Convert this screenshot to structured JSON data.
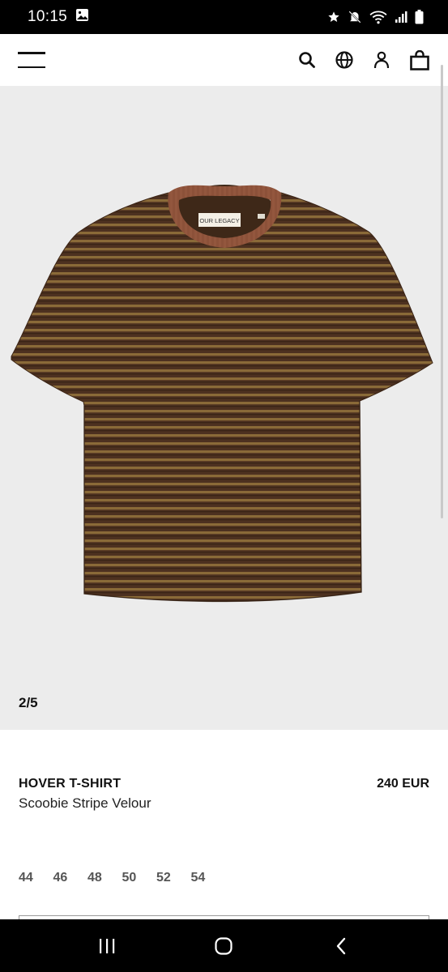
{
  "status_bar": {
    "time": "10:15",
    "icons": [
      "image-icon",
      "star-icon",
      "mute-icon",
      "wifi-icon",
      "signal-icon",
      "battery-icon"
    ]
  },
  "header": {
    "icons": [
      "menu-icon",
      "search-icon",
      "globe-icon",
      "account-icon",
      "bag-icon"
    ]
  },
  "gallery": {
    "counter": "2/5",
    "image_subject": "striped velour t-shirt",
    "label_text": "OUR LEGACY",
    "background_color": "#ececec",
    "shirt_color": "#5a3a22",
    "collar_color": "#8a4f38"
  },
  "product": {
    "name": "HOVER T-SHIRT",
    "variant": "Scoobie Stripe Velour",
    "price": "240 EUR",
    "sizes": [
      "44",
      "46",
      "48",
      "50",
      "52",
      "54"
    ]
  },
  "nav_bar": {
    "icons": [
      "recents-icon",
      "home-icon",
      "back-icon"
    ]
  }
}
